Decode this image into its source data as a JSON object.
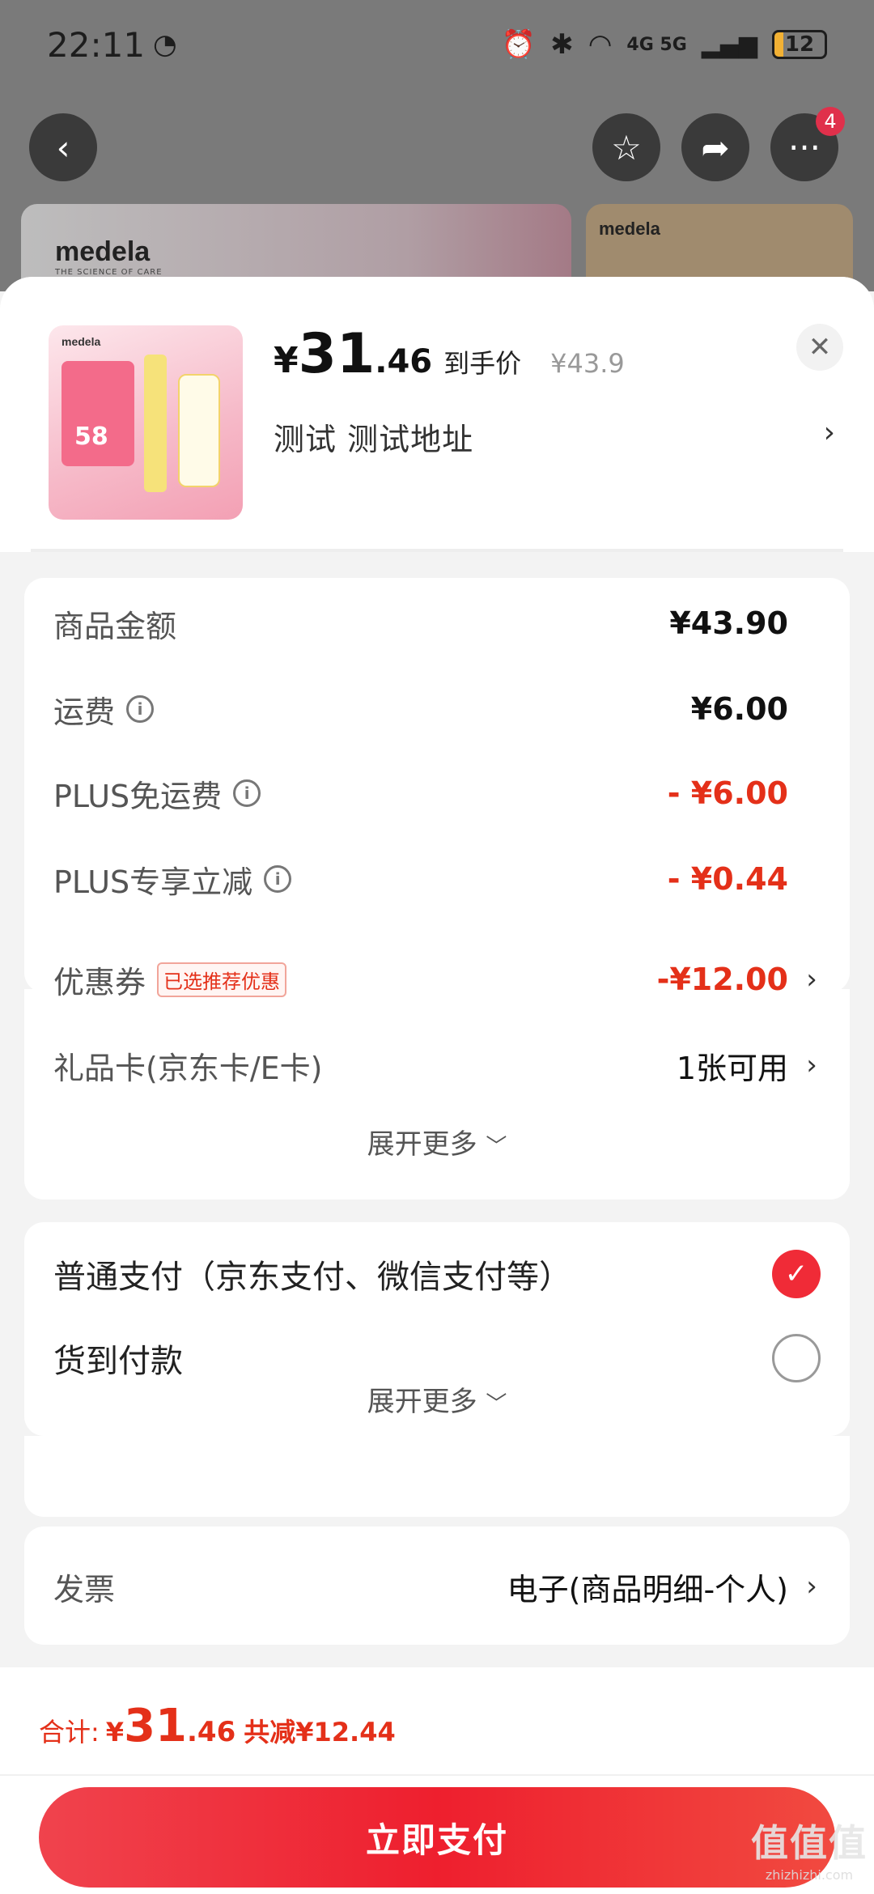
{
  "status_bar": {
    "time": "22:11",
    "network": "4G 5G",
    "battery": "12"
  },
  "nav": {
    "cart_badge": "4"
  },
  "banner": {
    "brand": "medela",
    "tagline": "THE SCIENCE OF CARE",
    "brand_2": "medela"
  },
  "product": {
    "price_symbol": "¥",
    "price_int": "31",
    "price_dec": ".46",
    "price_tag": "到手价",
    "original_price": "¥43.9",
    "address": "测试  测试地址",
    "thumb_brand": "medela",
    "thumb_badge": "58"
  },
  "costs": {
    "rows": [
      {
        "label": "商品金额",
        "value": "¥43.90"
      },
      {
        "label": "运费",
        "value": "¥6.00"
      },
      {
        "label": "PLUS免运费",
        "value": "- ¥6.00"
      },
      {
        "label": "PLUS专享立减",
        "value": "- ¥0.44"
      },
      {
        "label": "优惠券",
        "tag": "已选推荐优惠",
        "value": "-¥12.00"
      },
      {
        "label": "礼品卡(京东卡/E卡)",
        "value": "1张可用"
      }
    ],
    "expand": "展开更多"
  },
  "payment": {
    "options": [
      {
        "label": "普通支付（京东支付、微信支付等）",
        "selected": true
      },
      {
        "label": "货到付款",
        "selected": false
      }
    ],
    "expand": "展开更多"
  },
  "invoice": {
    "label": "发票",
    "value": "电子(商品明细-个人)"
  },
  "footer": {
    "total_label": "合计:",
    "total_symbol": "¥",
    "total_int": "31",
    "total_dec": ".46",
    "savings": "共减¥12.44",
    "pay_button": "立即支付"
  },
  "watermark": {
    "main": "值值值",
    "sub": "zhizhizhi.com"
  },
  "colors": {
    "accent_red": "#e43019",
    "button_red": "#ee1f2e"
  }
}
